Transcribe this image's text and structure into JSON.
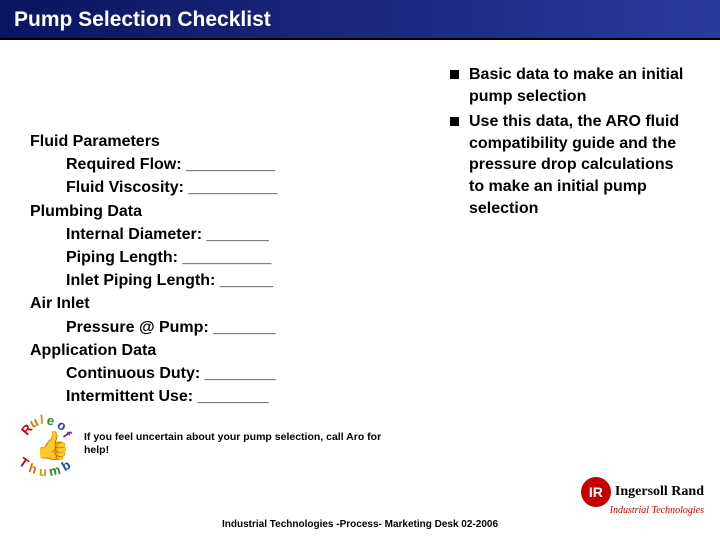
{
  "title": "Pump Selection Checklist",
  "checklist": {
    "group1_heading": "Fluid Parameters",
    "group1_field1": "Required Flow: __________",
    "group1_field2": "Fluid Viscosity: __________",
    "group2_heading": "Plumbing Data",
    "group2_field1": "Internal Diameter: _______",
    "group2_field2": "Piping Length: __________",
    "group2_field3": "Inlet Piping Length: ______",
    "group3_heading": "Air Inlet",
    "group3_field1": "Pressure @ Pump: _______",
    "group4_heading": "Application Data",
    "group4_field1": "Continuous Duty: ________",
    "group4_field2": "Intermittent Use: ________"
  },
  "bullets": {
    "b1": "Basic data to make an initial pump selection",
    "b2": "Use this data, the ARO fluid compatibility guide and the pressure drop calculations to make an initial pump selection"
  },
  "thumb": {
    "arc_top": "Rule of",
    "arc_bottom": "Thumb",
    "caption": "If you feel uncertain about your pump selection, call Aro for help!"
  },
  "footer": "Industrial Technologies -Process- Marketing Desk 02-2006",
  "logo": {
    "badge": "IR",
    "name": "Ingersoll Rand",
    "sub": "Industrial Technologies"
  }
}
